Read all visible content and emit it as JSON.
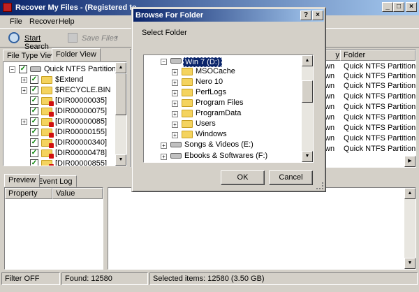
{
  "window": {
    "title": "Recover My Files  -  (Registered to"
  },
  "menu": [
    "File",
    "Recover",
    "Help"
  ],
  "toolbar": {
    "start_search": "Start Search",
    "save_files": "Save Files"
  },
  "left_tabs": [
    "File Type View",
    "Folder View"
  ],
  "tree": {
    "root": "Quick NTFS Partition 1",
    "items": [
      "$Extend",
      "$RECYCLE.BIN",
      "[DIR00000035]",
      "[DIR00000075]",
      "[DIR00000085]",
      "[DIR00000155]",
      "[DIR00000340]",
      "[DIR00000478]",
      "[DIR00000855]"
    ]
  },
  "list": {
    "col_partial": "y",
    "col_folder": "Folder",
    "rows": [
      {
        "a": "wn",
        "folder": "Quick NTFS Partition"
      },
      {
        "a": "wn",
        "folder": "Quick NTFS Partition"
      },
      {
        "a": "wn",
        "folder": "Quick NTFS Partition"
      },
      {
        "a": "wn",
        "folder": "Quick NTFS Partition"
      },
      {
        "a": "wn",
        "folder": "Quick NTFS Partition"
      },
      {
        "a": "wn",
        "folder": "Quick NTFS Partition"
      },
      {
        "a": "wn",
        "folder": "Quick NTFS Partition"
      },
      {
        "a": "wn",
        "folder": "Quick NTFS Partition"
      },
      {
        "a": "wn",
        "folder": "Quick NTFS Partition"
      }
    ]
  },
  "bottom_tabs": [
    "Preview",
    "Event Log"
  ],
  "props": {
    "col_property": "Property",
    "col_value": "Value"
  },
  "status": {
    "filter": "Filter OFF",
    "found": "Found: 12580",
    "selected": "Selected items: 12580 (3.50 GB)"
  },
  "dialog": {
    "title": "Browse For Folder",
    "prompt": "Select Folder",
    "drive": "Win 7 (D:)",
    "folders": [
      "MSOCache",
      "Nero 10",
      "PerfLogs",
      "Program Files",
      "ProgramData",
      "Users",
      "Windows"
    ],
    "next_drive": "Songs & Videos (E:)",
    "partial_drive": "Ebooks & Softwares (F:)",
    "ok": "OK",
    "cancel": "Cancel"
  }
}
